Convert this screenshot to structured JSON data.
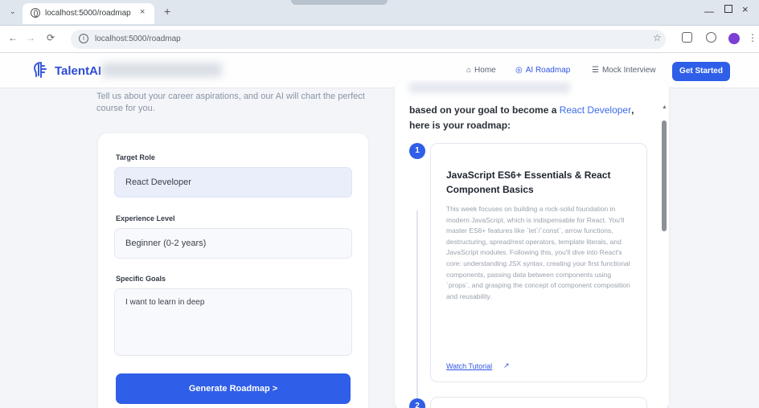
{
  "browser": {
    "tab_title": "localhost:5000/roadmap",
    "tab_close": "×",
    "tab_new": "+",
    "dropdown": "⌄",
    "url": "localhost:5000/roadmap",
    "back": "←",
    "forward": "→",
    "reload": "⟳",
    "star": "☆",
    "minimize": "—",
    "close": "×",
    "more": "⋮"
  },
  "navbar": {
    "logo_text": "TalentAI",
    "logo_icon": "brain-icon",
    "links": [
      {
        "label": "Home",
        "icon": "home-icon",
        "glyph": "⌂"
      },
      {
        "label": "AI Roadmap",
        "icon": "roadmap-icon",
        "glyph": "◎"
      },
      {
        "label": "Mock Interview",
        "icon": "list-icon",
        "glyph": "☰"
      }
    ],
    "cta_label": "Get Started"
  },
  "form": {
    "subtitle": "Tell us about your career aspirations, and our AI will chart the perfect course for you.",
    "target_role_label": "Target Role",
    "target_role_value": "React Developer",
    "experience_label": "Experience Level",
    "experience_value": "Beginner (0-2 years)",
    "goals_label": "Specific Goals",
    "goals_value": "I want to learn in deep",
    "generate_label": "Generate Roadmap  >"
  },
  "result": {
    "intro_pre": "based on your goal to become a",
    "intro_accent": "React Developer",
    "intro_post": ", here is your roadmap:",
    "steps": [
      {
        "number": "1",
        "title": "JavaScript ES6+ Essentials & React Component Basics",
        "description": "This week focuses on building a rock-solid foundation in modern JavaScript, which is indispensable for React. You'll master ES6+ features like `let`/`const`, arrow functions, destructuring, spread/rest operators, template literals, and JavaScript modules. Following this, you'll dive into React's core: understanding JSX syntax, creating your first functional components, passing data between components using `props`, and grasping the concept of component composition and reusability.",
        "link_label": "Watch Tutorial",
        "link_icon": "external-link-icon"
      },
      {
        "number": "2"
      }
    ]
  },
  "colors": {
    "accent": "#2f5ee8",
    "brand": "#2d4bd3"
  }
}
